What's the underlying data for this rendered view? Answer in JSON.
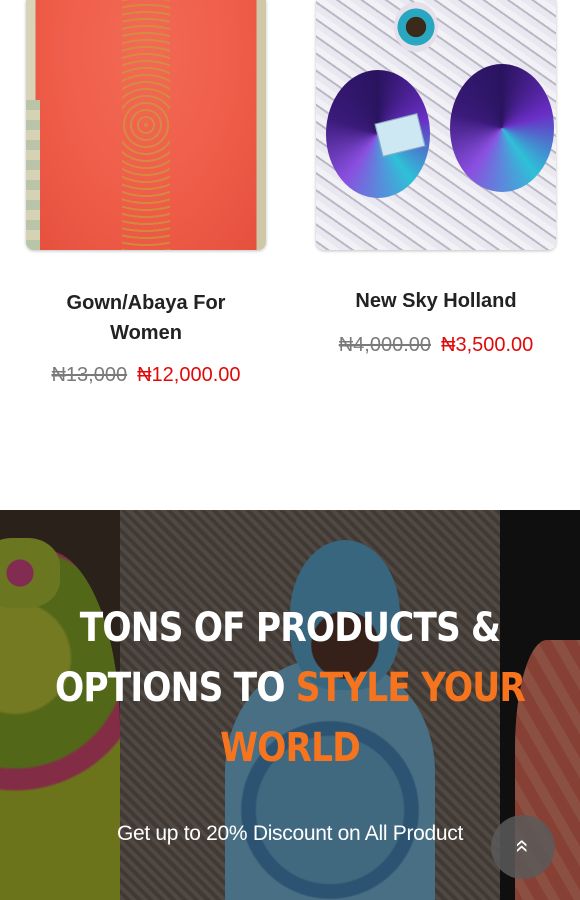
{
  "products": [
    {
      "title_line1": "Gown/Abaya For",
      "title_line2": "Women",
      "old_price": "₦13,000",
      "new_price": "₦12,000.00"
    },
    {
      "title_line1": "New Sky Holland",
      "old_price": "₦4,000.00",
      "new_price": "₦3,500.00"
    }
  ],
  "banner": {
    "headline_part1": "TONS OF PRODUCTS &",
    "headline_part2": "OPTIONS TO ",
    "headline_accent_1": "STYLE YOUR",
    "headline_accent_2": "WORLD",
    "subtitle": "Get up to 20% Discount on All Product",
    "accent_color": "#f7741e"
  },
  "scroll_top": {
    "icon": "double-chevron-up-icon",
    "glyph": "«"
  }
}
